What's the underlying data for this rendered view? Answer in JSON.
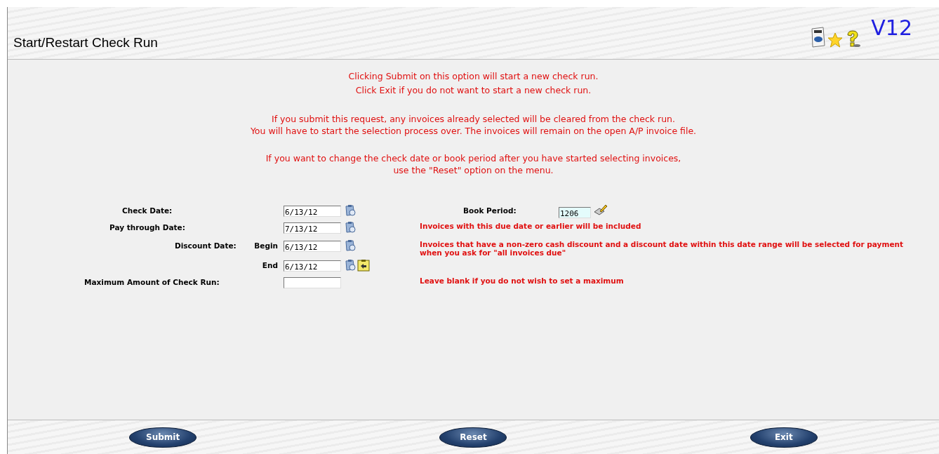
{
  "header": {
    "title": "Start/Restart Check Run",
    "version": "V12"
  },
  "messages": [
    [
      "Clicking Submit on this option will start a new check run.",
      "Click Exit if you do not want to start a new check run."
    ],
    [
      "If you submit this request, any invoices already selected will be cleared from the check run.",
      "You will have to start the selection process over. The invoices will remain on the open A/P invoice file."
    ],
    [
      "If you want to change the check date or book period after you have started selecting invoices,",
      "use the \"Reset\" option on the menu."
    ]
  ],
  "fields": [
    {
      "label": "Check Date:",
      "value": "6/13/12",
      "side": {
        "label": "Book Period:",
        "value": "1206"
      }
    },
    {
      "label": "Pay through Date:",
      "value": "7/13/12",
      "note": "Invoices with this due date or earlier will be included"
    },
    {
      "label": "Discount Date:",
      "sublabel": "Begin",
      "value": "6/13/12",
      "note": "Invoices that have a non-zero cash discount and a discount date within this date range will be selected for payment when you ask for \"all invoices due\""
    },
    {
      "sublabel": "End",
      "value": "6/13/12",
      "copy": true
    },
    {
      "label": "Maximum Amount of Check Run:",
      "kind": "amount",
      "note": "Leave blank if you do not wish to set a maximum"
    }
  ],
  "buttons": [
    "Submit",
    "Reset",
    "Exit"
  ]
}
